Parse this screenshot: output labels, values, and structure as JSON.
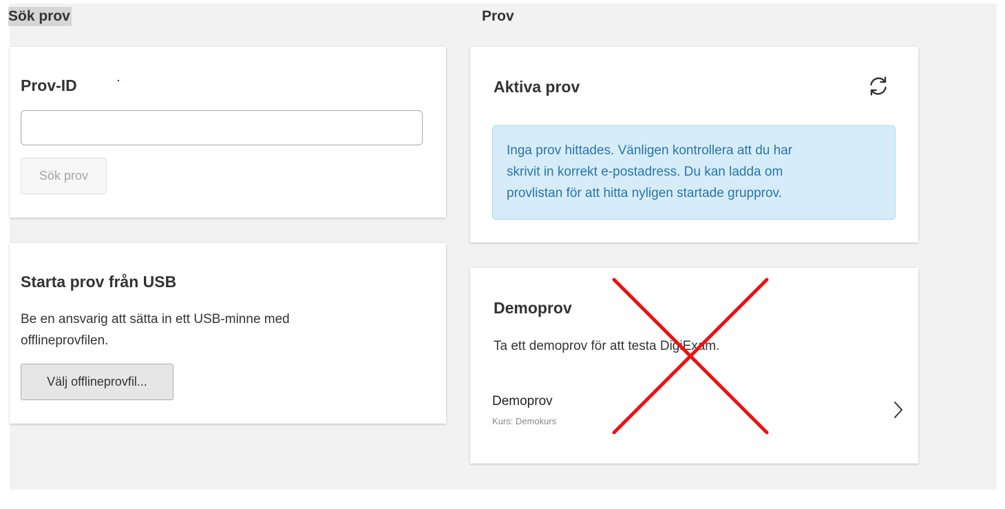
{
  "left_column": {
    "heading": "Sök prov",
    "provid_card": {
      "title": "Prov-ID",
      "input_value": "",
      "input_placeholder": "",
      "search_button_label": "Sök prov"
    },
    "usb_card": {
      "title": "Starta prov från USB",
      "description_line1": "Be en ansvarig att sätta in ett USB-minne med",
      "description_line2": "offlineprovfilen.",
      "choose_button_label": "Välj offlineprovfil..."
    }
  },
  "right_column": {
    "heading": "Prov",
    "active_card": {
      "title": "Aktiva prov",
      "refresh_icon": "refresh-icon",
      "alert_line1": "Inga prov hittades. Vänligen kontrollera att du har",
      "alert_line2": "skrivit in korrekt e-postadress. Du kan ladda om",
      "alert_line3": "provlistan för att hitta nyligen startade grupprov."
    },
    "demo_card": {
      "title": "Demoprov",
      "description": "Ta ett demoprov för att testa DigiExam.",
      "item_name": "Demoprov",
      "item_course": "Kurs: Demokurs",
      "chevron_icon": "chevron-right-icon"
    }
  },
  "colors": {
    "alert_bg": "#d6edf9",
    "alert_text": "#2a74a9",
    "cross_mark": "#ee1111"
  }
}
